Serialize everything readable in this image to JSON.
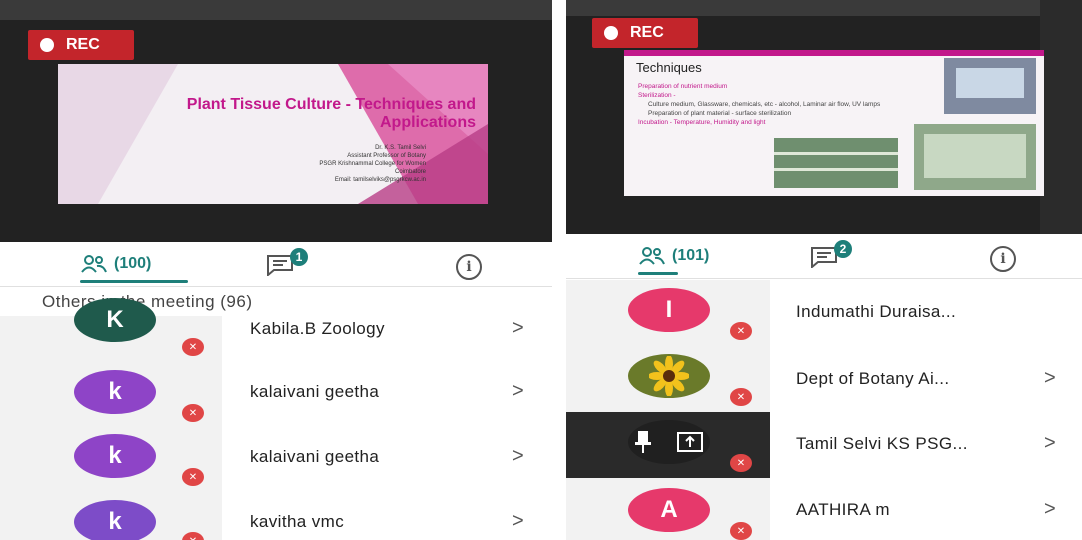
{
  "left": {
    "rec_label": "REC",
    "slide": {
      "title_line1": "Plant Tissue Culture - Techniques and",
      "title_line2": "Applications",
      "author": "Dr. K.S. Tamil Selvi",
      "role": "Assistant Professor of Botany",
      "college": "PSGR Krishnammal College for Women",
      "city": "Coimbatore",
      "email": "Email: tamilselviks@psgrkcw.ac.in"
    },
    "tabs": {
      "people_count": "(100)",
      "chat_badge": "1"
    },
    "section_title": "Others in the meeting (96)",
    "participants": [
      {
        "initial": "K",
        "name": "Kabila.B Zoology",
        "color": "#1f5a4c"
      },
      {
        "initial": "k",
        "name": "kalaivani geetha",
        "color": "#8e44c7"
      },
      {
        "initial": "k",
        "name": "kalaivani geetha",
        "color": "#8e44c7"
      },
      {
        "initial": "k",
        "name": "kavitha vmc",
        "color": "#7d4cc8"
      }
    ]
  },
  "right": {
    "rec_label": "REC",
    "slide": {
      "title": "Techniques",
      "b1": "Preparation of nutrient medium",
      "b2": "Sterilization -",
      "b2a": "Culture medium, Glassware, chemicals, etc - alcohol, Laminar air flow, UV lamps",
      "b2b": "Preparation of plant material - surface sterilization",
      "b3": "Incubation - Temperature, Humidity and light"
    },
    "tabs": {
      "people_count": "(101)",
      "chat_badge": "2"
    },
    "participants": [
      {
        "initial": "I",
        "name": "Indumathi Duraisa...",
        "color": "#e6396b",
        "chevron": false
      },
      {
        "initial": "",
        "name": "Dept of Botany Ai...",
        "color": "#6a7a2a",
        "chevron": true
      },
      {
        "initial": "",
        "name": "Tamil Selvi KS PSG...",
        "color": "#202020",
        "chevron": true
      },
      {
        "initial": "A",
        "name": "AATHIRA m",
        "color": "#e6396b",
        "chevron": true
      }
    ],
    "chevron": ">"
  },
  "chevron": ">",
  "colors": {
    "accent": "#1e7f7a",
    "rec": "#c3252b",
    "mute": "#e04646"
  }
}
